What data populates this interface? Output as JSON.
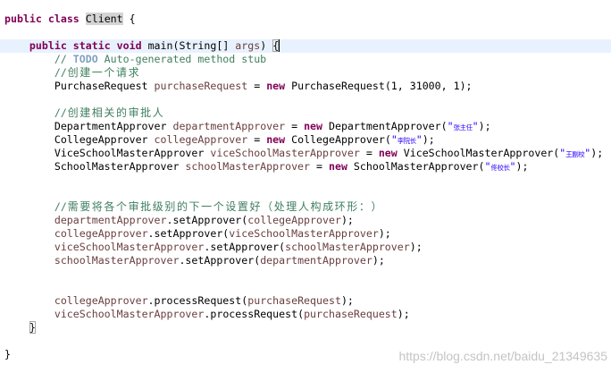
{
  "syntax_colors": {
    "plain": "#000000",
    "keyword": "#7F0055",
    "comment": "#3F7F5F",
    "task_tag": "#7F9FBF",
    "string": "#2A00FF",
    "variable": "#6A3E3E"
  },
  "highlight_colors": {
    "current_line": "#E8F2FE",
    "occurrence": "#D4D4D4",
    "bracket_match": "#A6A6A6"
  },
  "editor": {
    "lines": [
      {
        "tokens": [
          {
            "t": "public",
            "s": "keyword"
          },
          {
            "t": " "
          },
          {
            "t": "class",
            "s": "keyword"
          },
          {
            "t": " "
          },
          {
            "t": "Client",
            "occurrence": true
          },
          {
            "t": " {"
          }
        ]
      },
      {
        "tokens": []
      },
      {
        "current": true,
        "tokens": [
          {
            "t": "    "
          },
          {
            "t": "public",
            "s": "keyword"
          },
          {
            "t": " "
          },
          {
            "t": "static",
            "s": "keyword"
          },
          {
            "t": " "
          },
          {
            "t": "void",
            "s": "keyword"
          },
          {
            "t": " main(String[] "
          },
          {
            "t": "args",
            "s": "variable"
          },
          {
            "t": ") "
          },
          {
            "t": "{",
            "bracket_match": true,
            "cursor_after": true
          }
        ]
      },
      {
        "tokens": [
          {
            "t": "        // ",
            "s": "comment"
          },
          {
            "t": "TODO",
            "s": "task_tag"
          },
          {
            "t": " Auto-generated method stub",
            "s": "comment"
          }
        ]
      },
      {
        "tokens": [
          {
            "t": "        //创建一个请求",
            "s": "comment"
          }
        ]
      },
      {
        "tokens": [
          {
            "t": "        PurchaseRequest "
          },
          {
            "t": "purchaseRequest",
            "s": "variable"
          },
          {
            "t": " = "
          },
          {
            "t": "new",
            "s": "keyword"
          },
          {
            "t": " PurchaseRequest(1, 31000, 1);"
          }
        ]
      },
      {
        "tokens": []
      },
      {
        "tokens": [
          {
            "t": "        //创建相关的审批人",
            "s": "comment"
          }
        ]
      },
      {
        "tokens": [
          {
            "t": "        DepartmentApprover "
          },
          {
            "t": "departmentApprover",
            "s": "variable"
          },
          {
            "t": " = "
          },
          {
            "t": "new",
            "s": "keyword"
          },
          {
            "t": " DepartmentApprover("
          },
          {
            "t": "\"张主任\"",
            "s": "string"
          },
          {
            "t": ");"
          }
        ]
      },
      {
        "tokens": [
          {
            "t": "        CollegeApprover "
          },
          {
            "t": "collegeApprover",
            "s": "variable"
          },
          {
            "t": " = "
          },
          {
            "t": "new",
            "s": "keyword"
          },
          {
            "t": " CollegeApprover("
          },
          {
            "t": "\"李院长\"",
            "s": "string"
          },
          {
            "t": ");"
          }
        ]
      },
      {
        "tokens": [
          {
            "t": "        ViceSchoolMasterApprover "
          },
          {
            "t": "viceSchoolMasterApprover",
            "s": "variable"
          },
          {
            "t": " = "
          },
          {
            "t": "new",
            "s": "keyword"
          },
          {
            "t": " ViceSchoolMasterApprover("
          },
          {
            "t": "\"王副校\"",
            "s": "string"
          },
          {
            "t": ");"
          }
        ]
      },
      {
        "tokens": [
          {
            "t": "        SchoolMasterApprover "
          },
          {
            "t": "schoolMasterApprover",
            "s": "variable"
          },
          {
            "t": " = "
          },
          {
            "t": "new",
            "s": "keyword"
          },
          {
            "t": " SchoolMasterApprover("
          },
          {
            "t": "\"佟校长\"",
            "s": "string"
          },
          {
            "t": ");"
          }
        ]
      },
      {
        "tokens": []
      },
      {
        "tokens": []
      },
      {
        "tokens": [
          {
            "t": "        //需要将各个审批级别的下一个设置好（处理人构成环形：）",
            "s": "comment"
          }
        ]
      },
      {
        "tokens": [
          {
            "t": "        "
          },
          {
            "t": "departmentApprover",
            "s": "variable"
          },
          {
            "t": ".setApprover("
          },
          {
            "t": "collegeApprover",
            "s": "variable"
          },
          {
            "t": ");"
          }
        ]
      },
      {
        "tokens": [
          {
            "t": "        "
          },
          {
            "t": "collegeApprover",
            "s": "variable"
          },
          {
            "t": ".setApprover("
          },
          {
            "t": "viceSchoolMasterApprover",
            "s": "variable"
          },
          {
            "t": ");"
          }
        ]
      },
      {
        "tokens": [
          {
            "t": "        "
          },
          {
            "t": "viceSchoolMasterApprover",
            "s": "variable"
          },
          {
            "t": ".setApprover("
          },
          {
            "t": "schoolMasterApprover",
            "s": "variable"
          },
          {
            "t": ");"
          }
        ]
      },
      {
        "tokens": [
          {
            "t": "        "
          },
          {
            "t": "schoolMasterApprover",
            "s": "variable"
          },
          {
            "t": ".setApprover("
          },
          {
            "t": "departmentApprover",
            "s": "variable"
          },
          {
            "t": ");"
          }
        ]
      },
      {
        "tokens": []
      },
      {
        "tokens": []
      },
      {
        "tokens": [
          {
            "t": "        "
          },
          {
            "t": "collegeApprover",
            "s": "variable"
          },
          {
            "t": ".processRequest("
          },
          {
            "t": "purchaseRequest",
            "s": "variable"
          },
          {
            "t": ");"
          }
        ]
      },
      {
        "tokens": [
          {
            "t": "        "
          },
          {
            "t": "viceSchoolMasterApprover",
            "s": "variable"
          },
          {
            "t": ".processRequest("
          },
          {
            "t": "purchaseRequest",
            "s": "variable"
          },
          {
            "t": ");"
          }
        ]
      },
      {
        "tokens": [
          {
            "t": "    "
          },
          {
            "t": "}",
            "bracket_match": true
          }
        ]
      },
      {
        "tokens": []
      },
      {
        "tokens": [
          {
            "t": "}"
          }
        ]
      }
    ]
  },
  "watermark": "https://blog.csdn.net/baidu_21349635"
}
